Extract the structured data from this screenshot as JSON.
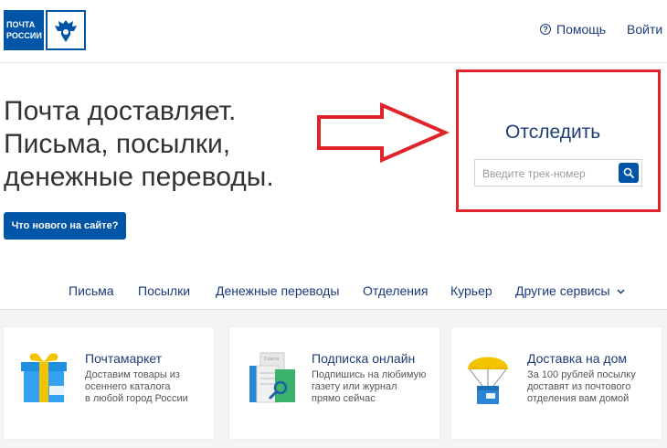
{
  "header": {
    "logo_line1": "ПОЧТА",
    "logo_line2": "РОССИИ",
    "help_label": "Помощь",
    "login_label": "Войти"
  },
  "hero": {
    "title_line1": "Почта доставляет.",
    "title_line2": "Письма, посылки,",
    "title_line3": "денежные переводы.",
    "whats_new_label": "Что нового на сайте?"
  },
  "tracking": {
    "title": "Отследить",
    "placeholder": "Введите трек-номер"
  },
  "nav": {
    "items": [
      "Письма",
      "Посылки",
      "Денежные переводы",
      "Отделения",
      "Курьер",
      "Другие сервисы"
    ]
  },
  "cards": [
    {
      "title": "Почтамаркет",
      "description": "Доставим товары из\nосеннего каталога\nв любой город России"
    },
    {
      "title": "Подписка онлайн",
      "description": "Подпишись на любимую\nгазету или журнал\nпрямо сейчас"
    },
    {
      "title": "Доставка на дом",
      "description": "За 100 рублей посылку\nдоставят из почтового\nотделения вам домой"
    }
  ],
  "colors": {
    "brand_blue": "#0055a6",
    "highlight_red": "#e1232b",
    "link_blue": "#1a3a7a"
  }
}
